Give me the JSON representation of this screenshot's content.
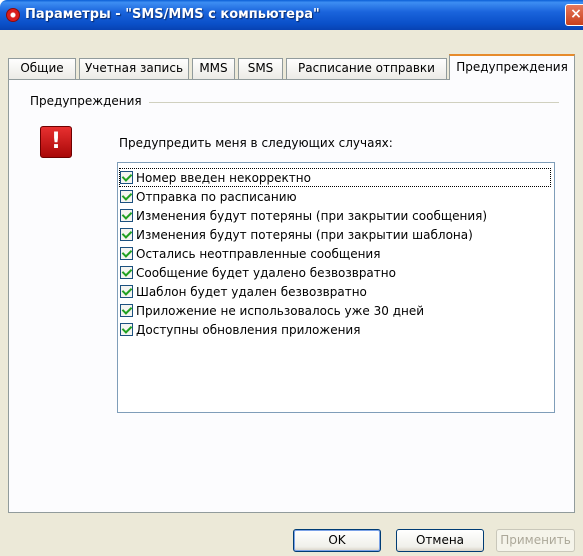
{
  "window": {
    "title": "Параметры - \"SMS/MMS с компьютера\"",
    "close_label": "×"
  },
  "tabs": [
    {
      "label": "Общие"
    },
    {
      "label": "Учетная запись"
    },
    {
      "label": "MMS"
    },
    {
      "label": "SMS"
    },
    {
      "label": "Расписание отправки"
    },
    {
      "label": "Предупреждения",
      "active": true
    }
  ],
  "panel": {
    "group_label": "Предупреждения",
    "icon": "warning-icon",
    "prompt": "Предупредить меня в следующих случаях:",
    "items": [
      {
        "label": "Номер введен некорректно",
        "checked": true
      },
      {
        "label": "Отправка по расписанию",
        "checked": true
      },
      {
        "label": "Изменения будут потеряны (при закрытии сообщения)",
        "checked": true
      },
      {
        "label": "Изменения будут потеряны (при закрытии шаблона)",
        "checked": true
      },
      {
        "label": "Остались неотправленные сообщения",
        "checked": true
      },
      {
        "label": "Сообщение будет удалено безвозвратно",
        "checked": true
      },
      {
        "label": "Шаблон будет удален безвозвратно",
        "checked": true
      },
      {
        "label": "Приложение не использовалось уже 30 дней",
        "checked": true
      },
      {
        "label": "Доступны обновления приложения",
        "checked": true
      }
    ]
  },
  "buttons": {
    "ok": "OK",
    "cancel": "Отмена",
    "apply": "Применить"
  }
}
